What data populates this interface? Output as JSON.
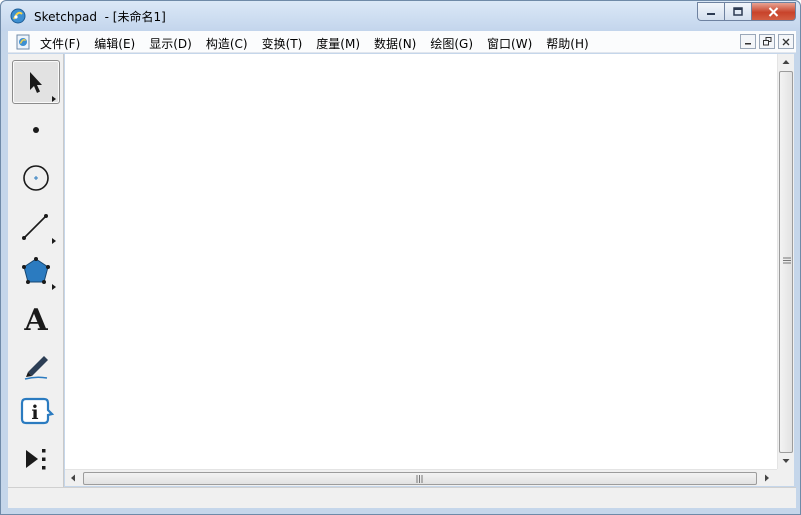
{
  "window": {
    "title": "Sketchpad  - [未命名1]"
  },
  "menu": {
    "items": [
      {
        "label": "文件(F)"
      },
      {
        "label": "编辑(E)"
      },
      {
        "label": "显示(D)"
      },
      {
        "label": "构造(C)"
      },
      {
        "label": "变换(T)"
      },
      {
        "label": "度量(M)"
      },
      {
        "label": "数据(N)"
      },
      {
        "label": "绘图(G)"
      },
      {
        "label": "窗口(W)"
      },
      {
        "label": "帮助(H)"
      }
    ]
  },
  "toolbox": {
    "tools": [
      {
        "name": "selection-arrow-tool",
        "icon": "arrow-pointer-icon",
        "selected": true
      },
      {
        "name": "point-tool",
        "icon": "point-icon",
        "selected": false
      },
      {
        "name": "compass-tool",
        "icon": "circle-icon",
        "selected": false
      },
      {
        "name": "straightedge-tool",
        "icon": "segment-icon",
        "selected": false
      },
      {
        "name": "polygon-tool",
        "icon": "polygon-icon",
        "selected": false
      },
      {
        "name": "text-tool",
        "icon": "text-a-icon",
        "selected": false
      },
      {
        "name": "marker-tool",
        "icon": "marker-pen-icon",
        "selected": false
      },
      {
        "name": "information-tool",
        "icon": "info-icon",
        "selected": false
      },
      {
        "name": "custom-tool",
        "icon": "custom-tool-icon",
        "selected": false
      }
    ],
    "text_tool_glyph": "A",
    "info_tool_glyph": "i"
  },
  "colors": {
    "titlebar": "#c5d6ea",
    "accent_blue": "#2b7bc0",
    "close_red": "#c8432a"
  }
}
